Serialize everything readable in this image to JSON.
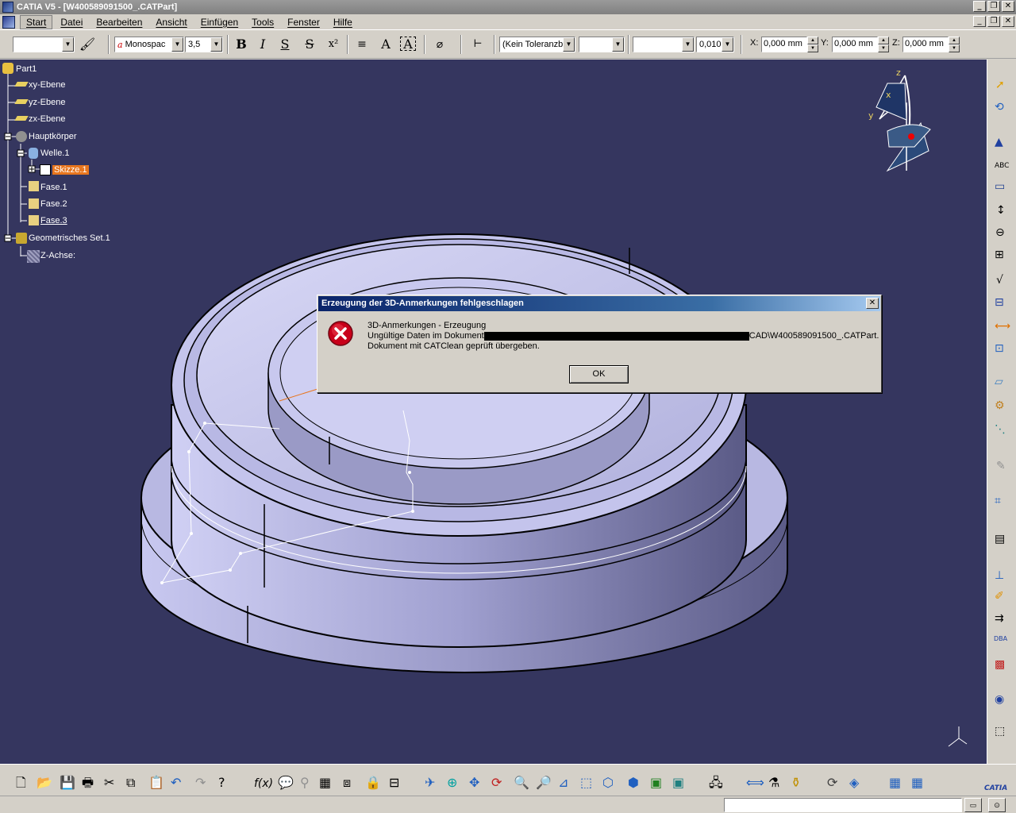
{
  "window": {
    "title": "CATIA V5 - [W400589091500_.CATPart]"
  },
  "menu": {
    "items": [
      "Start",
      "Datei",
      "Bearbeiten",
      "Ansicht",
      "Einfügen",
      "Tools",
      "Fenster",
      "Hilfe"
    ],
    "active": "Start"
  },
  "toolbar": {
    "font_name": "Monospac",
    "font_size": "3,5",
    "bold_label": "B",
    "italic_label": "I",
    "underline_label": "S",
    "strike_label": "S",
    "tolerance_combo": "(Kein Toleranzb",
    "precision_combo": "0,010",
    "x_label": "X:",
    "x_value": "0,000 mm",
    "y_label": "Y:",
    "y_value": "0,000 mm",
    "z_label": "Z:",
    "z_value": "0,000 mm"
  },
  "tree": {
    "root": "Part1",
    "items": [
      "xy-Ebene",
      "yz-Ebene",
      "zx-Ebene",
      "Hauptkörper",
      "Welle.1",
      "Skizze.1",
      "Fase.1",
      "Fase.2",
      "Fase.3",
      "Geometrisches Set.1",
      "Z-Achse:"
    ]
  },
  "compass": {
    "x": "x",
    "y": "y",
    "z": "z"
  },
  "dialog": {
    "title": "Erzeugung der 3D-Anmerkungen fehlgeschlagen",
    "line1": "3D-Anmerkungen - Erzeugung",
    "line2_prefix": "Ungültige Daten im Dokument",
    "line2_suffix": "CAD\\W400589091500_.CATPart.",
    "line3": "Dokument mit CATClean geprüft übergeben.",
    "ok_label": "OK",
    "close_label": "✕"
  },
  "colors": {
    "viewport_bg": "#35365f",
    "part_face": "#b4b4e0",
    "selection": "#e8761e",
    "dialog_title": "#0a246a"
  }
}
